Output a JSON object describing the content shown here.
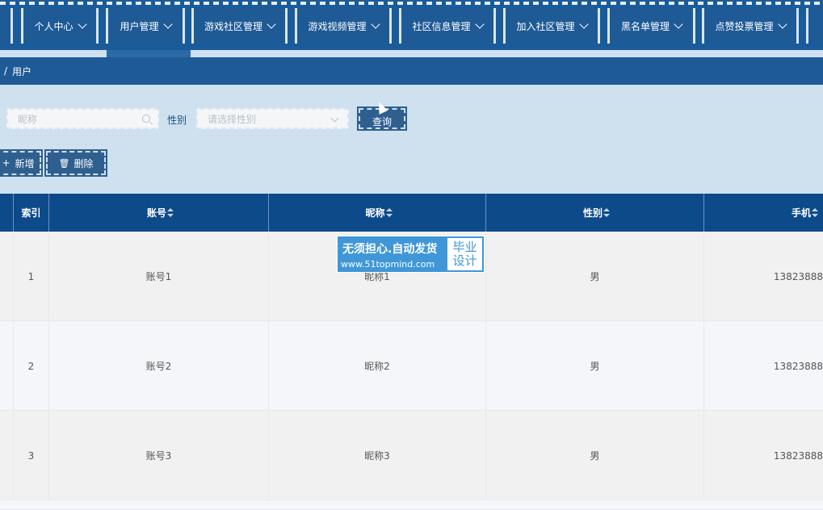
{
  "nav": [
    {
      "label": "个人中心"
    },
    {
      "label": "用户管理"
    },
    {
      "label": "游戏社区管理"
    },
    {
      "label": "游戏视频管理"
    },
    {
      "label": "社区信息管理"
    },
    {
      "label": "加入社区管理"
    },
    {
      "label": "黑名单管理"
    },
    {
      "label": "点赞投票管理"
    }
  ],
  "breadcrumb": {
    "separator": "/",
    "current": "用户"
  },
  "search": {
    "nickname_placeholder": "昵称",
    "gender_label": "性别",
    "gender_placeholder": "请选择性别",
    "query_button": "查询"
  },
  "actions": {
    "add": "新增",
    "delete": "删除"
  },
  "table": {
    "headers": [
      "索引",
      "账号",
      "昵称",
      "性别",
      "手机"
    ],
    "rows": [
      {
        "index": "1",
        "account": "账号1",
        "nickname": "昵称1",
        "gender": "男",
        "phone": "13823888"
      },
      {
        "index": "2",
        "account": "账号2",
        "nickname": "昵称2",
        "gender": "男",
        "phone": "13823888"
      },
      {
        "index": "3",
        "account": "账号3",
        "nickname": "昵称3",
        "gender": "男",
        "phone": "13823888"
      }
    ]
  },
  "watermark": {
    "line1": "无须担心.自动发货",
    "line2": "www.51topmind.com",
    "badge1": "毕业",
    "badge2": "设计"
  },
  "colors": {
    "nav": "#1e5a96",
    "table_header": "#0d4a8a",
    "panel": "#cfe0ef",
    "watermark": "#3f97d8"
  }
}
